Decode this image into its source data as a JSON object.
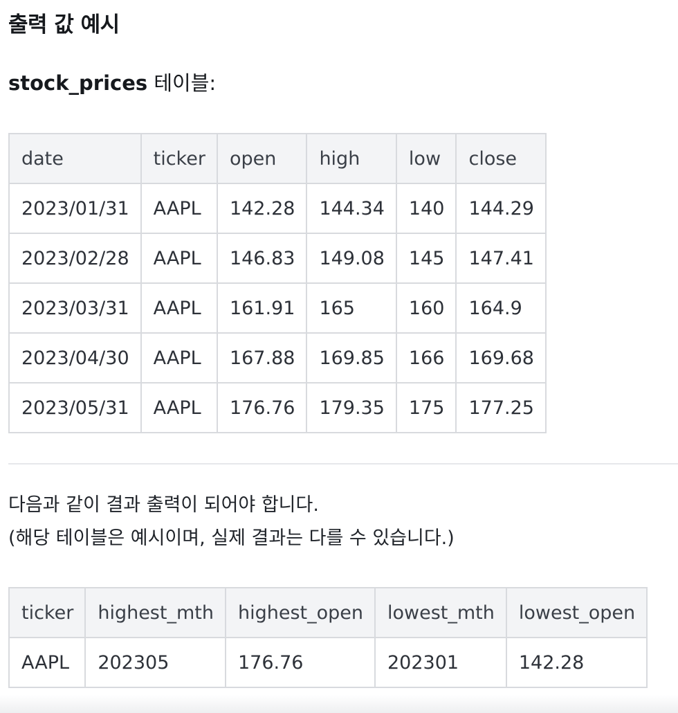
{
  "heading": "출력 값 예시",
  "caption": {
    "table_name": "stock_prices",
    "suffix": " 테이블:"
  },
  "stock_table": {
    "columns": [
      "date",
      "ticker",
      "open",
      "high",
      "low",
      "close"
    ],
    "rows": [
      [
        "2023/01/31",
        "AAPL",
        "142.28",
        "144.34",
        "140",
        "144.29"
      ],
      [
        "2023/02/28",
        "AAPL",
        "146.83",
        "149.08",
        "145",
        "147.41"
      ],
      [
        "2023/03/31",
        "AAPL",
        "161.91",
        "165",
        "160",
        "164.9"
      ],
      [
        "2023/04/30",
        "AAPL",
        "167.88",
        "169.85",
        "166",
        "169.68"
      ],
      [
        "2023/05/31",
        "AAPL",
        "176.76",
        "179.35",
        "175",
        "177.25"
      ]
    ]
  },
  "description": {
    "line1": "다음과 같이 결과 출력이 되어야 합니다.",
    "line2": "(해당 테이블은 예시이며, 실제 결과는 다를 수 있습니다.)"
  },
  "result_table": {
    "columns": [
      "ticker",
      "highest_mth",
      "highest_open",
      "lowest_mth",
      "lowest_open"
    ],
    "rows": [
      [
        "AAPL",
        "202305",
        "176.76",
        "202301",
        "142.28"
      ]
    ]
  }
}
